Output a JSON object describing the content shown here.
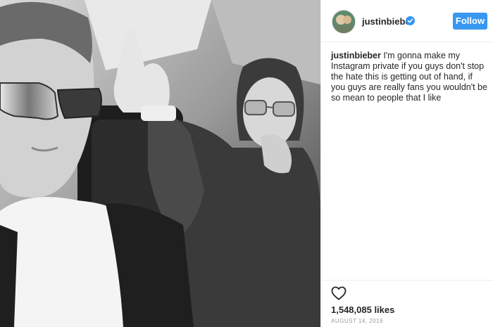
{
  "post": {
    "username": "justinbieber",
    "verified": true,
    "follow_label": "Follow",
    "caption_user": "justinbieber",
    "caption_text": " I'm gonna make my Instagram private if you guys don't stop the hate this is getting out of hand, if you guys are really fans you wouldn't be so mean to people that I like",
    "likes": "1,548,085 likes",
    "date": "AUGUST 14, 2016"
  },
  "icons": {
    "verified": "verified-badge-icon",
    "like": "heart-outline-icon"
  },
  "colors": {
    "follow_button": "#3897f0",
    "verified_badge": "#3897f0",
    "text": "#262626",
    "date": "#999999",
    "divider": "#efefef"
  }
}
